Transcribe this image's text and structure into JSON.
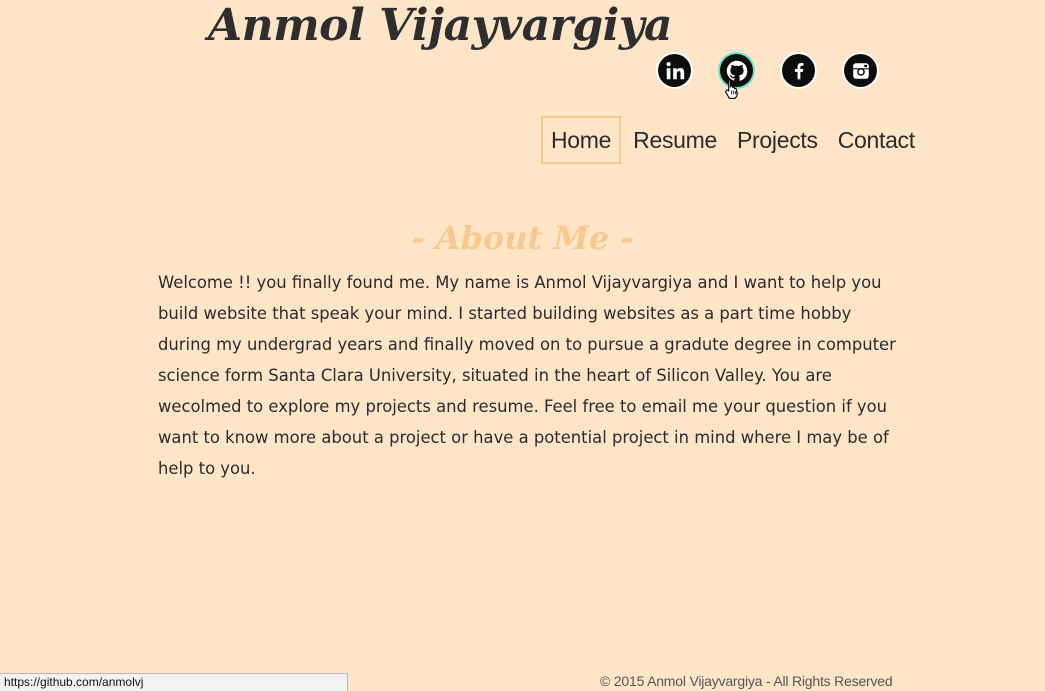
{
  "header": {
    "site_title": "Anmol Vijayvargiya"
  },
  "social": [
    {
      "name": "linkedin",
      "icon": "linkedin-icon",
      "active": false
    },
    {
      "name": "github",
      "icon": "github-icon",
      "active": true
    },
    {
      "name": "facebook",
      "icon": "facebook-icon",
      "active": false
    },
    {
      "name": "instagram",
      "icon": "instagram-icon",
      "active": false
    }
  ],
  "nav": {
    "items": [
      {
        "label": "Home",
        "active": true
      },
      {
        "label": "Resume",
        "active": false
      },
      {
        "label": "Projects",
        "active": false
      },
      {
        "label": "Contact",
        "active": false
      }
    ]
  },
  "about": {
    "heading": "- About Me -",
    "text": "Welcome !! you finally found me. My name is Anmol Vijayvargiya and I want to help you build website that speak your mind. I started building websites as a part time hobby during my undergrad years and finally moved on to pursue a gradute degree in computer science form Santa Clara University, situated in the heart of Silicon Valley. You are wecolmed to explore my projects and resume. Feel free to email me your question if you want to know more about a project or have a potential project in mind where I may be of help to you."
  },
  "footer": {
    "text": "© 2015 Anmol Vijayvargiya - All Rights Reserved"
  },
  "status_bar": {
    "url": "https://github.com/anmolvj"
  },
  "colors": {
    "background": "#ffe5c8",
    "accent": "#f7c990",
    "hover_ring": "#6fe0cc",
    "text": "#2b2b2b"
  }
}
